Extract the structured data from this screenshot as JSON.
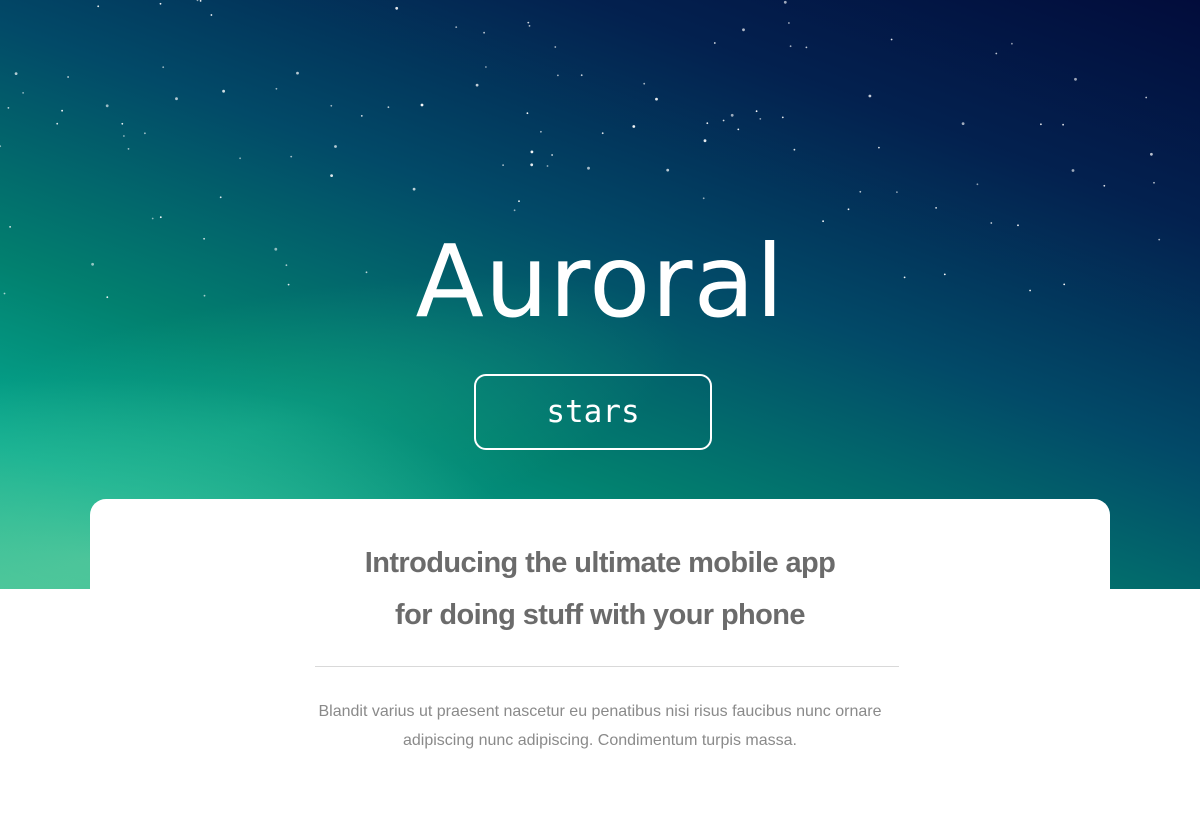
{
  "hero": {
    "title": "Auroral",
    "button_label": "stars",
    "colors": {
      "sky_top": "#020c3b",
      "sky_mid": "#024a68",
      "sky_bottom": "#05a98f",
      "text": "#ffffff"
    }
  },
  "intro": {
    "headline_line1": "Introducing the ultimate mobile app",
    "headline_line2": "for doing stuff with your phone",
    "body": "Blandit varius ut praesent nascetur eu penatibus nisi risus faucibus nunc ornare adipiscing nunc adipiscing. Condimentum turpis massa."
  }
}
